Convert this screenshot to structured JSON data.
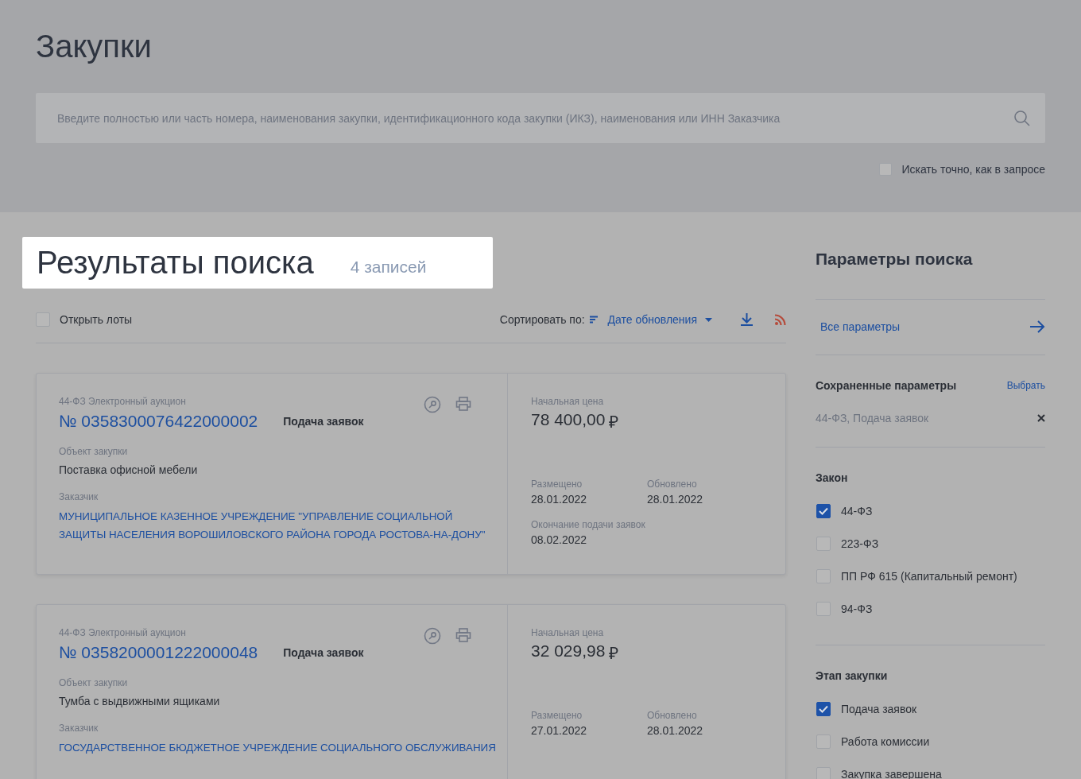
{
  "page_title": "Закупки",
  "search": {
    "placeholder": "Введите полностью или часть номера, наименования закупки, идентификационного кода закупки (ИКЗ), наименования или ИНН Заказчика"
  },
  "exact_search": {
    "label": "Искать точно, как в запросе",
    "checked": false
  },
  "results": {
    "title": "Результаты поиска",
    "count": "4 записей"
  },
  "toolbar": {
    "open_lots": {
      "label": "Открыть лоты",
      "checked": false
    },
    "sort_label": "Сортировать по:",
    "sort_value": "Дате обновления"
  },
  "cards": [
    {
      "type": "44-ФЗ Электронный аукцион",
      "number": "№ 0358300076422000002",
      "status": "Подача заявок",
      "object_label": "Объект закупки",
      "object": "Поставка офисной мебели",
      "customer_label": "Заказчик",
      "customer": "МУНИЦИПАЛЬНОЕ КАЗЕННОЕ УЧРЕЖДЕНИЕ \"УПРАВЛЕНИЕ СОЦИАЛЬНОЙ ЗАЩИТЫ НАСЕЛЕНИЯ ВОРОШИЛОВСКОГО РАЙОНА ГОРОДА РОСТОВА-НА-ДОНУ\"",
      "price_label": "Начальная цена",
      "price": "78 400,00",
      "currency": "₽",
      "posted_label": "Размещено",
      "posted": "28.01.2022",
      "updated_label": "Обновлено",
      "updated": "28.01.2022",
      "deadline_label": "Окончание подачи заявок",
      "deadline": "08.02.2022"
    },
    {
      "type": "44-ФЗ Электронный аукцион",
      "number": "№ 0358200001222000048",
      "status": "Подача заявок",
      "object_label": "Объект закупки",
      "object": "Тумба с выдвижными ящиками",
      "customer_label": "Заказчик",
      "customer": "ГОСУДАРСТВЕННОЕ БЮДЖЕТНОЕ УЧРЕЖДЕНИЕ СОЦИАЛЬНОГО ОБСЛУЖИВАНИЯ",
      "price_label": "Начальная цена",
      "price": "32 029,98",
      "currency": "₽",
      "posted_label": "Размещено",
      "posted": "27.01.2022",
      "updated_label": "Обновлено",
      "updated": "28.01.2022"
    }
  ],
  "sidebar": {
    "title": "Параметры поиска",
    "all_params": "Все параметры",
    "saved_title": "Сохраненные параметры",
    "saved_action": "Выбрать",
    "saved_item": "44-ФЗ, Подача заявок",
    "groups": [
      {
        "title": "Закон",
        "options": [
          {
            "label": "44-ФЗ",
            "checked": true
          },
          {
            "label": "223-ФЗ",
            "checked": false
          },
          {
            "label": "ПП РФ 615 (Капитальный ремонт)",
            "checked": false
          },
          {
            "label": "94-ФЗ",
            "checked": false
          }
        ]
      },
      {
        "title": "Этап закупки",
        "options": [
          {
            "label": "Подача заявок",
            "checked": true
          },
          {
            "label": "Работа комиссии",
            "checked": false
          },
          {
            "label": "Закупка завершена",
            "checked": false
          }
        ]
      }
    ]
  }
}
